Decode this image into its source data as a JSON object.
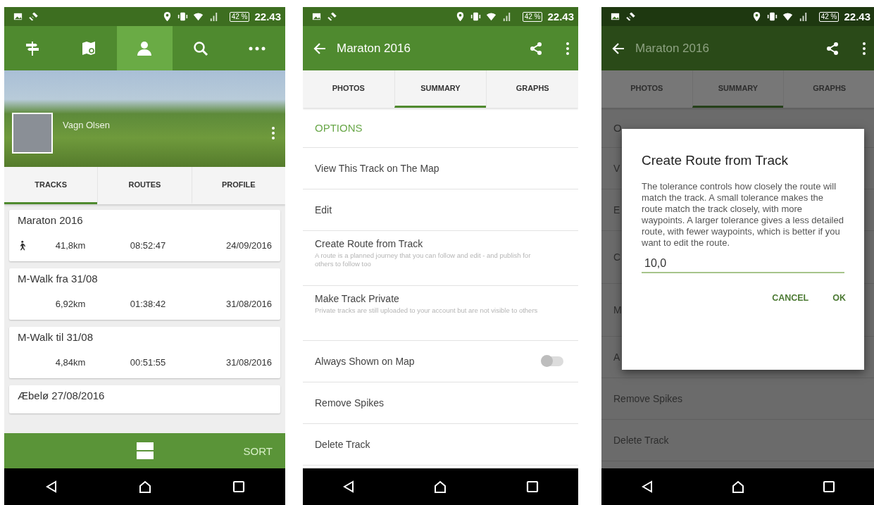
{
  "tracks_screen": {
    "status_bar": {
      "battery": "42 %",
      "time": "22.43"
    },
    "toolbar": [
      {
        "kind": "signpost",
        "selected": false
      },
      {
        "kind": "map",
        "selected": false
      },
      {
        "kind": "person",
        "selected": true
      },
      {
        "kind": "search",
        "selected": false
      },
      {
        "kind": "more",
        "selected": false
      }
    ],
    "profile": {
      "name": "Vagn Olsen"
    },
    "tabs": [
      {
        "label": "TRACKS",
        "selected": true
      },
      {
        "label": "ROUTES",
        "selected": false
      },
      {
        "label": "PROFILE",
        "selected": false
      }
    ],
    "tracks": [
      {
        "name": "Maraton 2016",
        "walking": true,
        "distance": "41,8km",
        "duration": "08:52:47",
        "date": "24/09/2016"
      },
      {
        "name": "M-Walk fra 31/08",
        "walking": false,
        "distance": "6,92km",
        "duration": "01:38:42",
        "date": "31/08/2016"
      },
      {
        "name": "M-Walk til 31/08",
        "walking": false,
        "distance": "4,84km",
        "duration": "00:51:55",
        "date": "31/08/2016"
      },
      {
        "name": "Æbelø 27/08/2016"
      }
    ],
    "bottom_bar": {
      "sort": "SORT"
    }
  },
  "summary_screen": {
    "status_bar": {
      "battery": "42 %",
      "time": "22.43"
    },
    "title": "Maraton 2016",
    "tabs": [
      {
        "label": "PHOTOS",
        "selected": false
      },
      {
        "label": "SUMMARY",
        "selected": true
      },
      {
        "label": "GRAPHS",
        "selected": false
      }
    ],
    "section": "OPTIONS",
    "options": [
      {
        "kind": "plain",
        "label": "View This Track on The Map"
      },
      {
        "kind": "plain",
        "label": "Edit"
      },
      {
        "kind": "plain",
        "label": "Create Route from Track",
        "description": "A route is a planned journey that you can follow and edit - and publish for others to follow too"
      },
      {
        "kind": "plain",
        "label": "Make Track Private",
        "description": "Private tracks are still uploaded to your account but are not visible to others"
      },
      {
        "kind": "toggle",
        "label": "Always Shown on Map",
        "on": false
      },
      {
        "kind": "plain",
        "label": "Remove Spikes"
      },
      {
        "kind": "plain",
        "label": "Delete Track"
      }
    ]
  },
  "dialog_screen": {
    "status_bar": {
      "battery": "42 %",
      "time": "22.43"
    },
    "title": "Maraton 2016",
    "tabs": [
      {
        "label": "PHOTOS",
        "selected": false
      },
      {
        "label": "SUMMARY",
        "selected": true
      },
      {
        "label": "GRAPHS",
        "selected": false
      }
    ],
    "rows": [
      {
        "kind": "section",
        "label": "O"
      },
      {
        "kind": "plain",
        "label": "V"
      },
      {
        "kind": "plain",
        "label": "E"
      },
      {
        "kind": "tall",
        "label": "C"
      },
      {
        "kind": "tall",
        "label": "M"
      },
      {
        "kind": "plain",
        "label": "A"
      },
      {
        "kind": "plain",
        "label": "Remove Spikes"
      },
      {
        "kind": "plain",
        "label": "Delete Track"
      }
    ],
    "dialog": {
      "title": "Create Route from Track",
      "message": "The tolerance controls how closely the route will match the track. A small tolerance makes the route match the track closely, with more waypoints. A larger tolerance gives a less detailed route, with fewer waypoints, which is better if you want to edit the route.",
      "value": "10,0",
      "buttons": [
        "CANCEL",
        "OK"
      ]
    }
  }
}
